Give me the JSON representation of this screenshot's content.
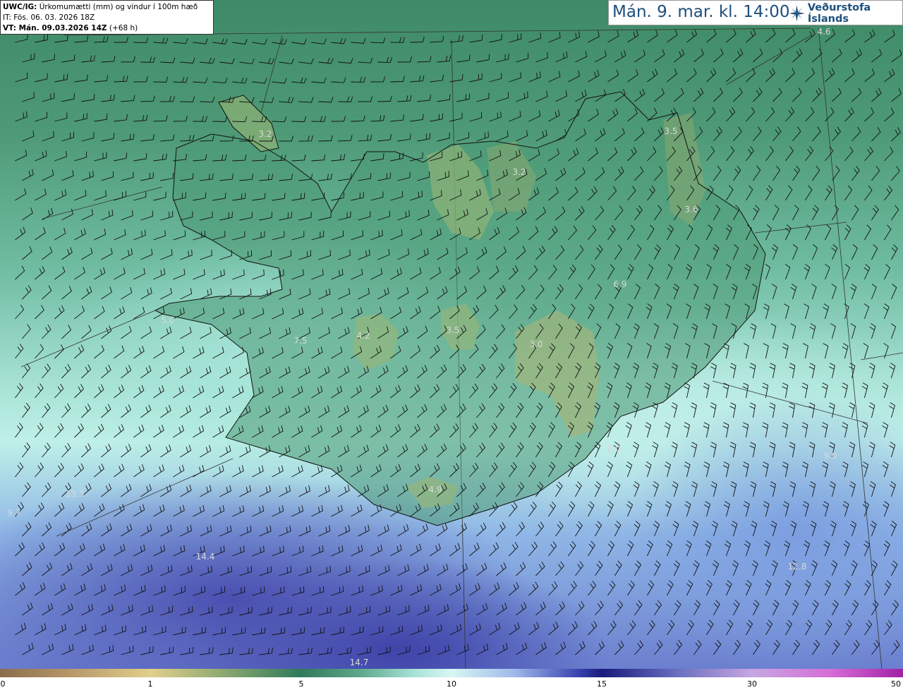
{
  "header": {
    "product_code": "UWC/IG:",
    "product_desc": "Úrkomumætti (mm) og vindur í 100m hæð",
    "init_label": "IT:",
    "init_time": "Fös. 06. 03. 2026 18Z",
    "valid_label": "VT: Mán. 09.03.2026 14Z",
    "valid_offset": "(+68 h)"
  },
  "time_banner": "Mán. 9. mar. kl. 14:00",
  "logo": {
    "text": "Veðurstofa Íslands",
    "icon": "vedurstofa-star-icon"
  },
  "field_values": [
    "4.6",
    "3.2",
    "3.5",
    "3.2",
    "3.6",
    "6.9",
    "5.0",
    "4.2",
    "3.5",
    "3.0",
    "4.9",
    "13.3",
    "9.7",
    "14.4",
    "14.7",
    "12.8",
    "7.5",
    "8.0",
    "9.0"
  ],
  "colorbar": {
    "ticks": [
      "0",
      "1",
      "5",
      "10",
      "15",
      "30",
      "50"
    ]
  },
  "colors": {
    "land_high": "#8aa770",
    "land_low": "#2f7a5a",
    "sea_wet": "#3a44b0",
    "coast_line": "#111111",
    "banner_text": "#1d4f7c"
  }
}
